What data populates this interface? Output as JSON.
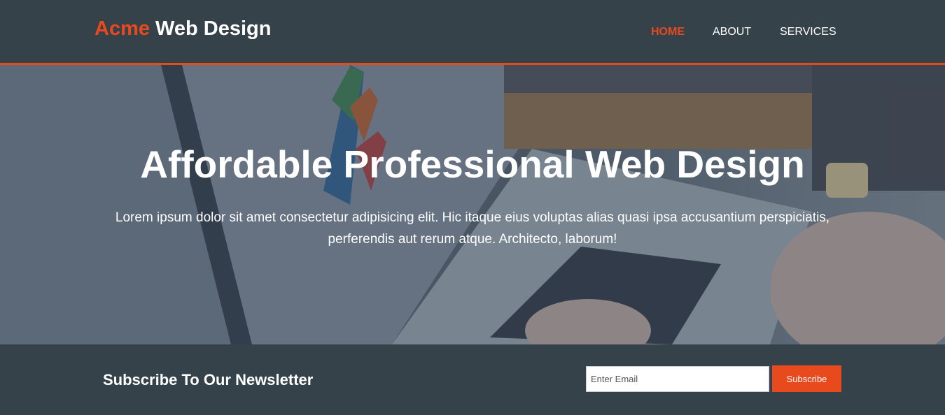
{
  "header": {
    "logo_highlight": "Acme",
    "logo_rest": " Web Design",
    "nav": [
      {
        "label": "HOME",
        "active": true
      },
      {
        "label": "ABOUT",
        "active": false
      },
      {
        "label": "SERVICES",
        "active": false
      }
    ]
  },
  "hero": {
    "title": "Affordable Professional Web Design",
    "text": "Lorem ipsum dolor sit amet consectetur adipisicing elit. Hic itaque eius voluptas alias quasi ipsa accusantium perspiciatis, perferendis aut rerum atque. Architecto, laborum!"
  },
  "newsletter": {
    "heading": "Subscribe To Our Newsletter",
    "email_placeholder": "Enter Email",
    "subscribe_label": "Subscribe"
  },
  "colors": {
    "accent": "#e8491d",
    "dark": "#35424a"
  }
}
